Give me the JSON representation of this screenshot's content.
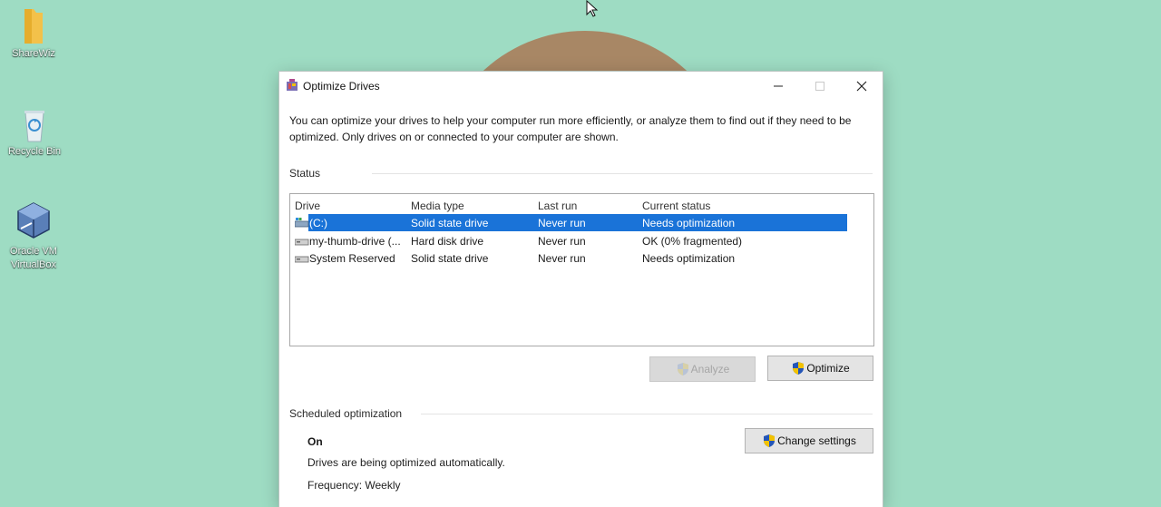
{
  "desktop": {
    "icons": [
      {
        "label": "ShareWiz",
        "icon": "folder-icon"
      },
      {
        "label": "Recycle Bin",
        "icon": "recycle-bin-icon"
      },
      {
        "label": "Oracle VM VirtualBox",
        "icon": "virtualbox-icon"
      }
    ]
  },
  "window": {
    "title": "Optimize Drives",
    "intro": "You can optimize your drives to help your computer run more efficiently, or analyze them to find out if they need to be optimized. Only drives on or connected to your computer are shown.",
    "status_label": "Status",
    "columns": [
      "Drive",
      "Media type",
      "Last run",
      "Current status"
    ],
    "drives": [
      {
        "drive": "(C:)",
        "media_type": "Solid state drive",
        "last_run": "Never run",
        "status": "Needs optimization",
        "selected": true
      },
      {
        "drive": "my-thumb-drive (...",
        "media_type": "Hard disk drive",
        "last_run": "Never run",
        "status": "OK (0% fragmented)",
        "selected": false
      },
      {
        "drive": "System Reserved",
        "media_type": "Solid state drive",
        "last_run": "Never run",
        "status": "Needs optimization",
        "selected": false
      }
    ],
    "analyze_label": "Analyze",
    "optimize_label": "Optimize",
    "scheduled_label": "Scheduled optimization",
    "schedule_state": "On",
    "schedule_desc": "Drives are being optimized automatically.",
    "frequency": "Frequency: Weekly",
    "change_settings_label": "Change settings"
  },
  "colors": {
    "desktop_bg": "#9edcc3",
    "selection": "#1a73d8",
    "shield_blue": "#2456b8",
    "shield_yellow": "#f2c200"
  }
}
